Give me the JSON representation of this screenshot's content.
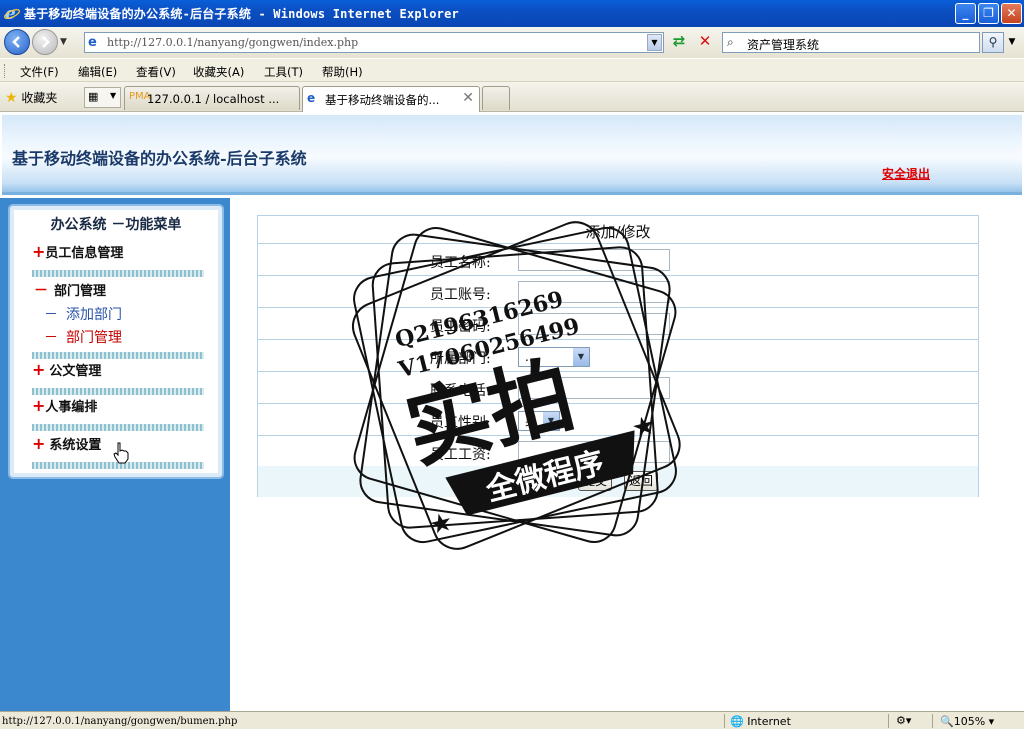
{
  "window": {
    "title": "基于移动终端设备的办公系统-后台子系统 - Windows Internet Explorer",
    "buttons": {
      "minimize": "_",
      "restore": "❐",
      "close": "✕"
    }
  },
  "address_bar": {
    "url": "http://127.0.0.1/nanyang/gongwen/index.php",
    "search_text": "资产管理系统"
  },
  "menu_bar": {
    "items": [
      "文件(F)",
      "编辑(E)",
      "查看(V)",
      "收藏夹(A)",
      "工具(T)",
      "帮助(H)"
    ]
  },
  "tab_bar": {
    "favorites_label": "收藏夹",
    "tabs": [
      {
        "label": "127.0.0.1 / localhost ...",
        "icon": "phpmyadmin-icon"
      },
      {
        "label": "基于移动终端设备的...",
        "icon": "ie-page-icon",
        "active": true
      }
    ]
  },
  "page": {
    "header_title": "基于移动终端设备的办公系统-后台子系统",
    "logout_link": "安全退出",
    "sidebar": {
      "heading": "办公系统 －功能菜单",
      "items": [
        {
          "label": "员工信息管理",
          "prefix": "+"
        },
        {
          "label": "部门管理",
          "prefix": "－"
        },
        {
          "label": "公文管理",
          "prefix": "+"
        },
        {
          "label": "人事编排",
          "prefix": "+"
        },
        {
          "label": "系统设置",
          "prefix": "+"
        }
      ],
      "sub_items": [
        {
          "label": "添加部门",
          "prefix": "－"
        },
        {
          "label": "部门管理",
          "prefix": "－"
        }
      ]
    },
    "form": {
      "caption": "添加/修改",
      "fields": [
        {
          "label": "员工名称:",
          "type": "text",
          "value": ""
        },
        {
          "label": "员工账号:",
          "type": "text",
          "value": ""
        },
        {
          "label": "员工密码:",
          "type": "text",
          "value": ""
        },
        {
          "label": "所属部门:",
          "type": "select",
          "value": "..."
        },
        {
          "label": "联系电话:",
          "type": "text",
          "value": ""
        },
        {
          "label": "员工性别:",
          "type": "select",
          "value": "男"
        },
        {
          "label": "员工工资:",
          "type": "text",
          "value": ""
        }
      ],
      "submit_label": "提交",
      "back_label": "返回"
    }
  },
  "watermark": {
    "line1": "Q2196316269",
    "line2": "V17060256499",
    "big": "实拍",
    "banner": "全微程序"
  },
  "status_bar": {
    "url": "http://127.0.0.1/nanyang/gongwen/bumen.php",
    "zone": "Internet",
    "zoom": "105%"
  }
}
